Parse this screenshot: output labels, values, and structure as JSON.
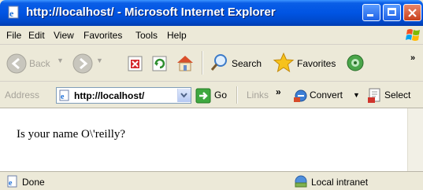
{
  "window": {
    "title": "http://localhost/ - Microsoft Internet Explorer"
  },
  "menu": [
    "File",
    "Edit",
    "View",
    "Favorites",
    "Tools",
    "Help"
  ],
  "toolbar": {
    "back_label": "Back",
    "search_label": "Search",
    "favorites_label": "Favorites"
  },
  "address": {
    "label": "Address",
    "value": "http://localhost/",
    "go_label": "Go",
    "links_label": "Links",
    "chevron": "»",
    "convert_label": "Convert",
    "select_label": "Select"
  },
  "content": {
    "text": "Is your name O\\'reilly?"
  },
  "status": {
    "left": "Done",
    "zone": "Local intranet"
  },
  "icons": {
    "back": "back-arrow-icon",
    "forward": "forward-arrow-icon",
    "stop": "stop-icon",
    "refresh": "refresh-icon",
    "home": "home-icon",
    "search": "search-icon",
    "favorites": "favorites-star-icon",
    "media": "media-icon",
    "go": "go-arrow-icon"
  }
}
